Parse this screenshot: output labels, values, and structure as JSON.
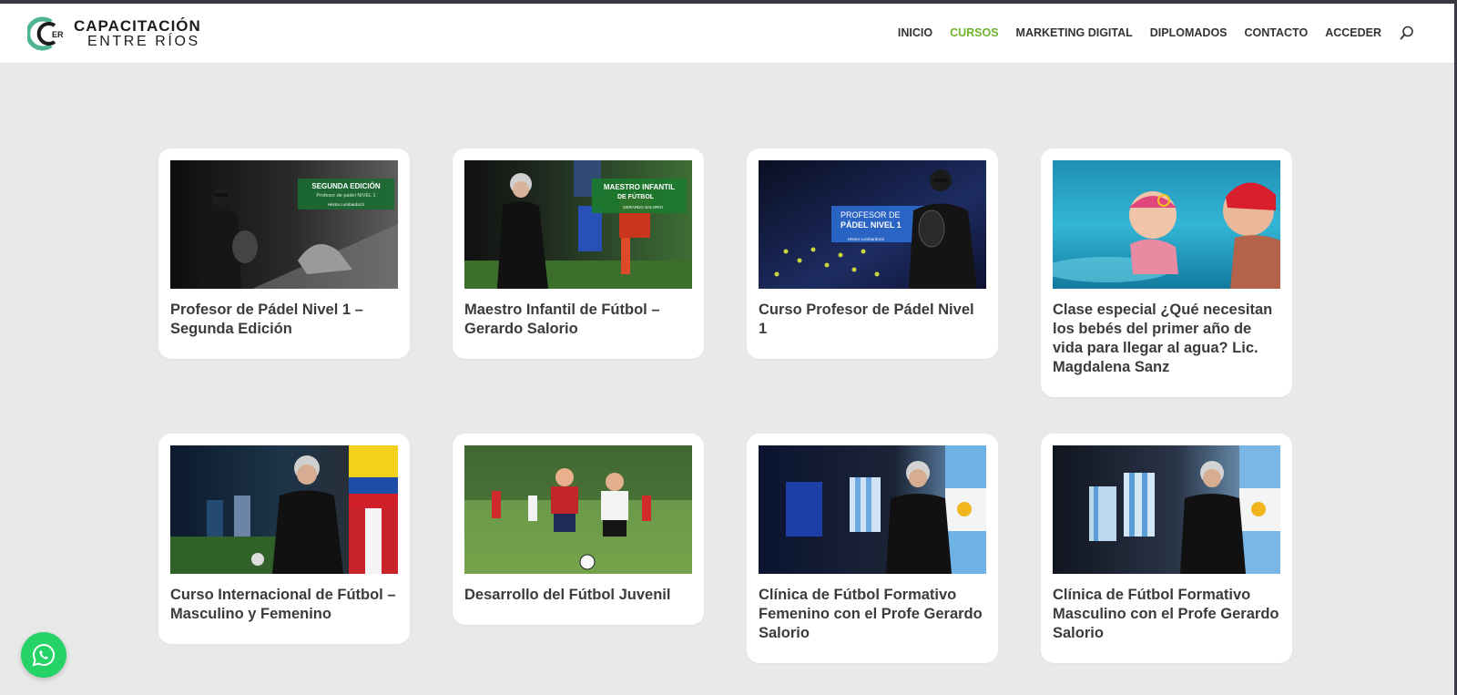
{
  "site": {
    "logo_line1": "CAPACITACIÓN",
    "logo_line2": "ENTRE RÍOS",
    "logo_mark_text": "ER"
  },
  "nav": {
    "items": [
      {
        "label": "INICIO"
      },
      {
        "label": "CURSOS"
      },
      {
        "label": "MARKETING DIGITAL"
      },
      {
        "label": "DIPLOMADOS"
      },
      {
        "label": "CONTACTO"
      },
      {
        "label": "ACCEDER"
      }
    ],
    "active": "CURSOS",
    "search_icon": "search-icon"
  },
  "colors": {
    "accent": "#6fb42c",
    "whatsapp": "#25d366",
    "page_bg": "#e9e9e9"
  },
  "courses": [
    {
      "title": "Profesor de Pádel Nivel 1 – Segunda Edición",
      "thumb_text": [
        "SEGUNDA EDICIÓN",
        "Profesor de pádel NIVEL 1",
        "Héctor Lombardozzi"
      ]
    },
    {
      "title": "Maestro Infantil de Fútbol – Gerardo Salorio",
      "thumb_text": [
        "MAESTRO INFANTIL",
        "DE FÚTBOL",
        "GERARDO SALORIO"
      ]
    },
    {
      "title": "Curso Profesor de Pádel Nivel 1",
      "thumb_text": [
        "PROFESOR DE",
        "PÁDEL NIVEL 1",
        "Héctor Lombardozzi"
      ]
    },
    {
      "title": "Clase especial ¿Qué necesitan los bebés del primer año de vida para llegar al agua? Lic. Magdalena Sanz",
      "thumb_text": []
    },
    {
      "title": "Curso Internacional de Fútbol – Masculino y Femenino",
      "thumb_text": []
    },
    {
      "title": "Desarrollo del Fútbol Juvenil",
      "thumb_text": []
    },
    {
      "title": "Clínica de Fútbol Formativo Femenino con el Profe Gerardo Salorio",
      "thumb_text": []
    },
    {
      "title": "Clínica de Fútbol Formativo Masculino con el Profe Gerardo Salorio",
      "thumb_text": []
    }
  ],
  "whatsapp": {
    "icon": "whatsapp-icon"
  }
}
